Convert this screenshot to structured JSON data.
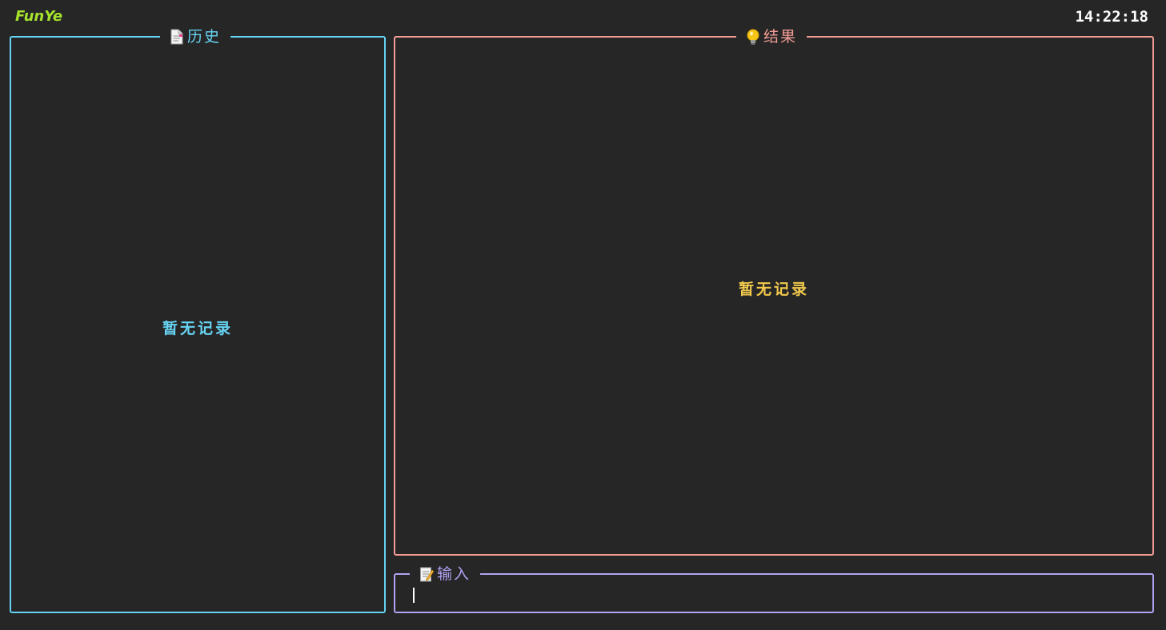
{
  "app": {
    "brand": "FunYe",
    "clock": "14:22:18"
  },
  "colors": {
    "brand": "#a6e22e",
    "history": "#66d3f2",
    "result": "#f29c94",
    "result_empty": "#f2c94c",
    "input": "#b3a1f2",
    "background": "#262626"
  },
  "history": {
    "title": "历史",
    "icon": "document-icon",
    "empty_text": "暂无记录"
  },
  "result": {
    "title": "结果",
    "icon": "lightbulb-icon",
    "empty_text": "暂无记录"
  },
  "input": {
    "title": "输入",
    "icon": "memo-icon",
    "value": ""
  }
}
